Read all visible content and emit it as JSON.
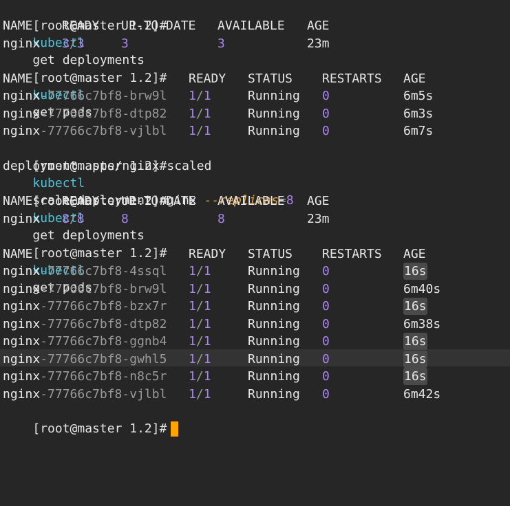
{
  "prompt": "[root@master 1.2]#",
  "commands": [
    {
      "cmd": "kubectl",
      "args": "get deployments"
    },
    {
      "cmd": "kubectl",
      "args": "get pods"
    },
    {
      "cmd": "kubectl",
      "args": "scale deployment nginx ",
      "flag": "--replicas",
      "eq": "=",
      "val": "8"
    },
    {
      "cmd": "kubectl",
      "args": "get deployments"
    },
    {
      "cmd": "kubectl",
      "args": "get pods"
    }
  ],
  "deploy_headers": [
    "NAME",
    "READY",
    "UP-TO-DATE",
    "AVAILABLE",
    "AGE"
  ],
  "deploy1": {
    "name": "nginx",
    "ready_a": "3",
    "ready_sep": "/",
    "ready_b": "3",
    "uptodate": "3",
    "available": "3",
    "age": "23m"
  },
  "pod_headers": [
    "NAME",
    "READY",
    "STATUS",
    "RESTARTS",
    "AGE"
  ],
  "pods1": [
    {
      "prefix": "nginx",
      "suffix": "-77766c7bf8-brw9l",
      "ready_a": "1",
      "ready_b": "1",
      "status": "Running",
      "restarts": "0",
      "age": "6m5s"
    },
    {
      "prefix": "nginx",
      "suffix": "-77766c7bf8-dtp82",
      "ready_a": "1",
      "ready_b": "1",
      "status": "Running",
      "restarts": "0",
      "age": "6m3s"
    },
    {
      "prefix": "nginx",
      "suffix": "-77766c7bf8-vjlbl",
      "ready_a": "1",
      "ready_b": "1",
      "status": "Running",
      "restarts": "0",
      "age": "6m7s"
    }
  ],
  "scale_output": "deployment.apps/nginx scaled",
  "deploy2": {
    "name": "nginx",
    "ready_a": "8",
    "ready_sep": "/",
    "ready_b": "8",
    "uptodate": "8",
    "available": "8",
    "age": "23m"
  },
  "pods2": [
    {
      "prefix": "nginx",
      "suffix": "-77766c7bf8-4ssql",
      "ready_a": "1",
      "ready_b": "1",
      "status": "Running",
      "restarts": "0",
      "age": "16s"
    },
    {
      "prefix": "nginx",
      "suffix": "-77766c7bf8-brw9l",
      "ready_a": "1",
      "ready_b": "1",
      "status": "Running",
      "restarts": "0",
      "age": "6m40s"
    },
    {
      "prefix": "nginx",
      "suffix": "-77766c7bf8-bzx7r",
      "ready_a": "1",
      "ready_b": "1",
      "status": "Running",
      "restarts": "0",
      "age": "16s"
    },
    {
      "prefix": "nginx",
      "suffix": "-77766c7bf8-dtp82",
      "ready_a": "1",
      "ready_b": "1",
      "status": "Running",
      "restarts": "0",
      "age": "6m38s"
    },
    {
      "prefix": "nginx",
      "suffix": "-77766c7bf8-ggnb4",
      "ready_a": "1",
      "ready_b": "1",
      "status": "Running",
      "restarts": "0",
      "age": "16s"
    },
    {
      "prefix": "nginx",
      "suffix": "-77766c7bf8-gwhl5",
      "ready_a": "1",
      "ready_b": "1",
      "status": "Running",
      "restarts": "0",
      "age": "16s"
    },
    {
      "prefix": "nginx",
      "suffix": "-77766c7bf8-n8c5r",
      "ready_a": "1",
      "ready_b": "1",
      "status": "Running",
      "restarts": "0",
      "age": "16s"
    },
    {
      "prefix": "nginx",
      "suffix": "-77766c7bf8-vjlbl",
      "ready_a": "1",
      "ready_b": "1",
      "status": "Running",
      "restarts": "0",
      "age": "6m42s"
    }
  ],
  "colors": {
    "background": "#262626",
    "command": "#4fc3d9",
    "number": "#a885e8",
    "flag": "#e8a33d",
    "cursor": "#ffa500"
  }
}
